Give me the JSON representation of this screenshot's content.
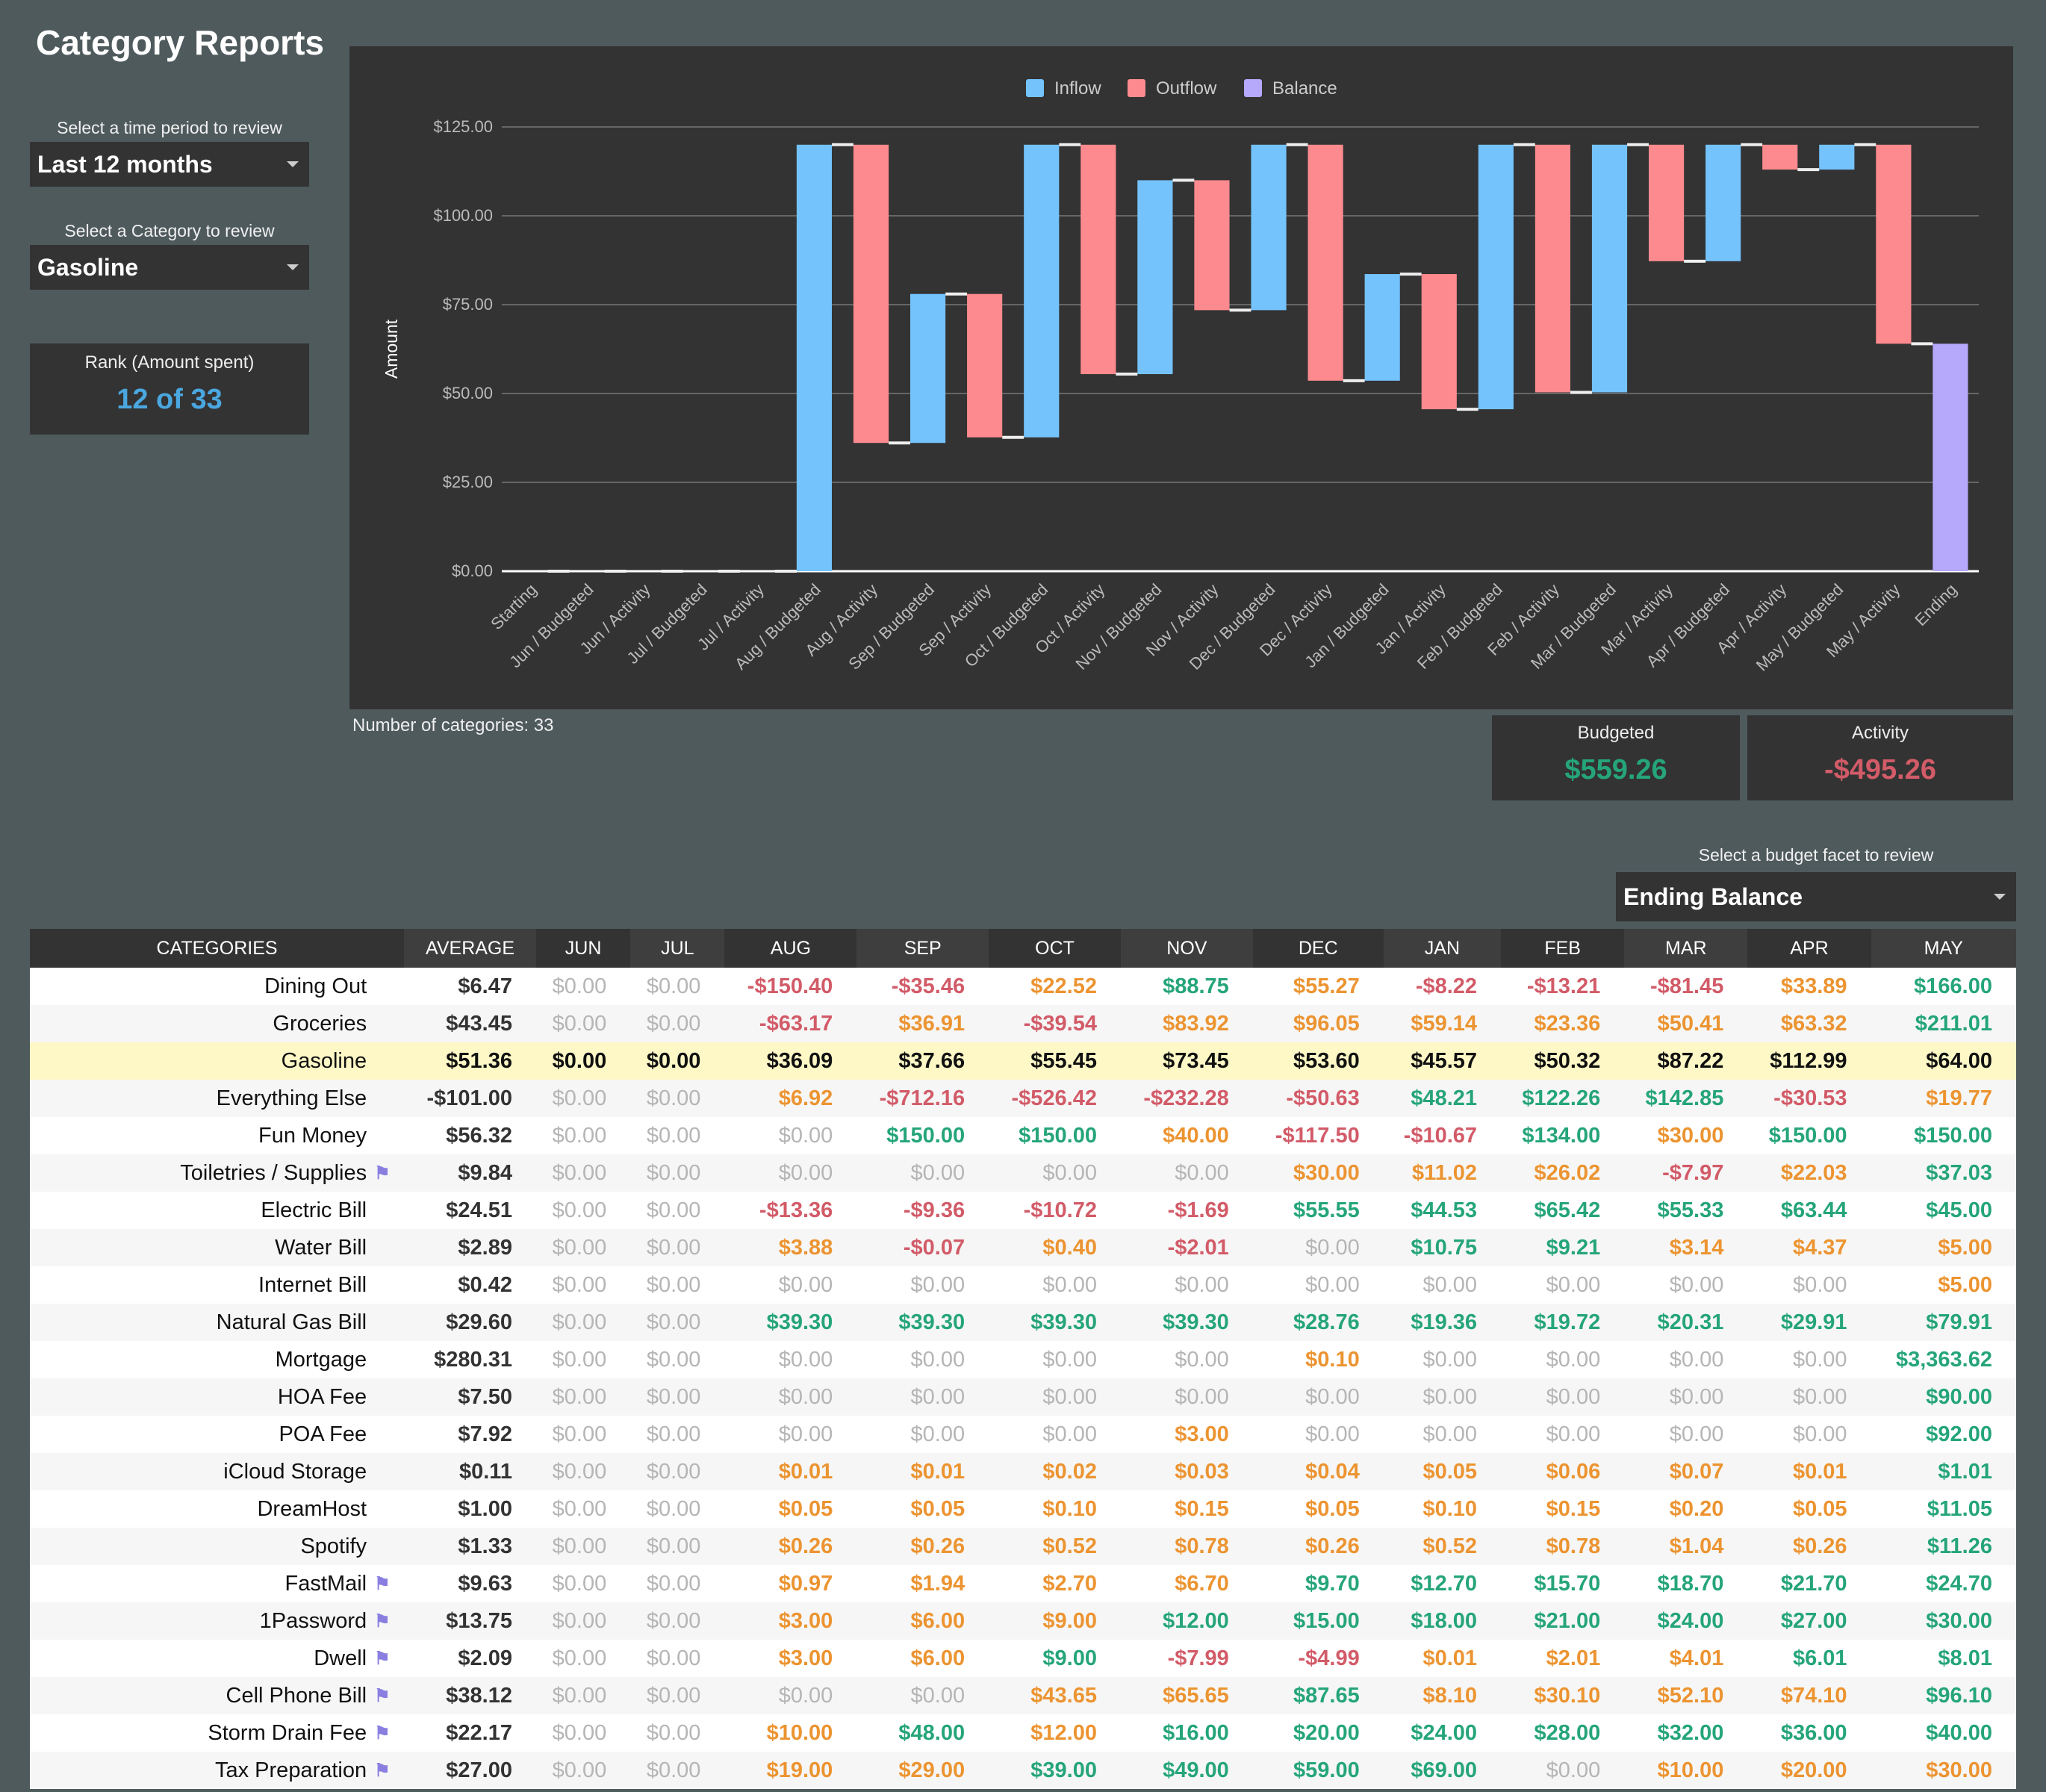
{
  "page": {
    "title": "Category Reports",
    "time_period": {
      "label": "Select a time period to review",
      "value": "Last 12 months"
    },
    "category_select": {
      "label": "Select a Category to review",
      "value": "Gasoline"
    },
    "rank": {
      "label": "Rank (Amount spent)",
      "value": "12 of 33"
    },
    "categories_count": "Number of categories: 33",
    "budgeted": {
      "label": "Budgeted",
      "value": "$559.26"
    },
    "activity": {
      "label": "Activity",
      "value": "-$495.26"
    },
    "facet_select": {
      "label": "Select a budget facet to review",
      "value": "Ending Balance"
    }
  },
  "colors": {
    "inflow": "#74c3fd",
    "outflow": "#fd8a8e",
    "balance": "#b6a8fb",
    "positive": "#25a579",
    "warning": "#ec9431",
    "negative": "#d25b68",
    "rank": "#4aa7e0"
  },
  "chart_data": {
    "type": "bar",
    "subtype": "waterfall",
    "ylabel": "Amount",
    "xlabel": "",
    "ylim": [
      0,
      125
    ],
    "yticks": [
      "$0.00",
      "$25.00",
      "$50.00",
      "$75.00",
      "$100.00",
      "$125.00"
    ],
    "grid": true,
    "legend": {
      "position": "top",
      "entries": [
        "Inflow",
        "Outflow",
        "Balance"
      ]
    },
    "categories": [
      "Starting",
      "Jun / Budgeted",
      "Jun / Activity",
      "Jul / Budgeted",
      "Jul / Activity",
      "Aug / Budgeted",
      "Aug / Activity",
      "Sep / Budgeted",
      "Sep / Activity",
      "Oct / Budgeted",
      "Oct / Activity",
      "Nov / Budgeted",
      "Nov / Activity",
      "Dec / Budgeted",
      "Dec / Activity",
      "Jan / Budgeted",
      "Jan / Activity",
      "Feb / Budgeted",
      "Feb / Activity",
      "Mar / Budgeted",
      "Mar / Activity",
      "Apr / Budgeted",
      "Apr / Activity",
      "May / Budgeted",
      "May / Activity",
      "Ending"
    ],
    "values": [
      0,
      0,
      0,
      0,
      0,
      120.0,
      -83.91,
      41.91,
      -40.34,
      82.34,
      -64.55,
      54.55,
      -36.55,
      46.55,
      -66.4,
      30.0,
      -38.03,
      74.43,
      -69.68,
      69.68,
      -32.78,
      32.78,
      -7.01,
      7.01,
      -56.0,
      64.0
    ],
    "kinds": [
      "balance",
      "inflow",
      "outflow",
      "inflow",
      "outflow",
      "inflow",
      "outflow",
      "inflow",
      "outflow",
      "inflow",
      "outflow",
      "inflow",
      "outflow",
      "inflow",
      "outflow",
      "inflow",
      "outflow",
      "inflow",
      "outflow",
      "inflow",
      "outflow",
      "inflow",
      "outflow",
      "inflow",
      "outflow",
      "balance"
    ]
  },
  "table": {
    "headers": [
      "CATEGORIES",
      "AVERAGE",
      "JUN",
      "JUL",
      "AUG",
      "SEP",
      "OCT",
      "NOV",
      "DEC",
      "JAN",
      "FEB",
      "MAR",
      "APR",
      "MAY"
    ],
    "rows": [
      {
        "name": "Dining Out",
        "flag": false,
        "avg": "$6.47",
        "months": [
          "$0.00",
          "$0.00",
          "-$150.40",
          "-$35.46",
          "$22.52",
          "$88.75",
          "$55.27",
          "-$8.22",
          "-$13.21",
          "-$81.45",
          "$33.89",
          "$166.00"
        ],
        "tones": [
          "z",
          "z",
          "n",
          "n",
          "o",
          "g",
          "o",
          "n",
          "n",
          "n",
          "o",
          "g"
        ]
      },
      {
        "name": "Groceries",
        "flag": false,
        "avg": "$43.45",
        "months": [
          "$0.00",
          "$0.00",
          "-$63.17",
          "$36.91",
          "-$39.54",
          "$83.92",
          "$96.05",
          "$59.14",
          "$23.36",
          "$50.41",
          "$63.32",
          "$211.01"
        ],
        "tones": [
          "z",
          "z",
          "n",
          "o",
          "n",
          "o",
          "o",
          "o",
          "o",
          "o",
          "o",
          "g"
        ]
      },
      {
        "name": "Gasoline",
        "flag": false,
        "highlight": true,
        "avg": "$51.36",
        "months": [
          "$0.00",
          "$0.00",
          "$36.09",
          "$37.66",
          "$55.45",
          "$73.45",
          "$53.60",
          "$45.57",
          "$50.32",
          "$87.22",
          "$112.99",
          "$64.00"
        ],
        "tones": [
          "h",
          "h",
          "h",
          "h",
          "h",
          "h",
          "h",
          "h",
          "h",
          "h",
          "h",
          "h"
        ]
      },
      {
        "name": "Everything Else",
        "flag": false,
        "avg": "-$101.00",
        "months": [
          "$0.00",
          "$0.00",
          "$6.92",
          "-$712.16",
          "-$526.42",
          "-$232.28",
          "-$50.63",
          "$48.21",
          "$122.26",
          "$142.85",
          "-$30.53",
          "$19.77"
        ],
        "tones": [
          "z",
          "z",
          "o",
          "n",
          "n",
          "n",
          "n",
          "g",
          "g",
          "g",
          "n",
          "o"
        ]
      },
      {
        "name": "Fun Money",
        "flag": false,
        "avg": "$56.32",
        "months": [
          "$0.00",
          "$0.00",
          "$0.00",
          "$150.00",
          "$150.00",
          "$40.00",
          "-$117.50",
          "-$10.67",
          "$134.00",
          "$30.00",
          "$150.00",
          "$150.00"
        ],
        "tones": [
          "z",
          "z",
          "z",
          "g",
          "g",
          "o",
          "n",
          "n",
          "g",
          "o",
          "g",
          "g"
        ]
      },
      {
        "name": "Toiletries / Supplies",
        "flag": true,
        "avg": "$9.84",
        "months": [
          "$0.00",
          "$0.00",
          "$0.00",
          "$0.00",
          "$0.00",
          "$0.00",
          "$30.00",
          "$11.02",
          "$26.02",
          "-$7.97",
          "$22.03",
          "$37.03"
        ],
        "tones": [
          "z",
          "z",
          "z",
          "z",
          "z",
          "z",
          "o",
          "o",
          "o",
          "n",
          "o",
          "g"
        ]
      },
      {
        "name": "Electric Bill",
        "flag": false,
        "avg": "$24.51",
        "months": [
          "$0.00",
          "$0.00",
          "-$13.36",
          "-$9.36",
          "-$10.72",
          "-$1.69",
          "$55.55",
          "$44.53",
          "$65.42",
          "$55.33",
          "$63.44",
          "$45.00"
        ],
        "tones": [
          "z",
          "z",
          "n",
          "n",
          "n",
          "n",
          "g",
          "g",
          "g",
          "g",
          "g",
          "g"
        ]
      },
      {
        "name": "Water Bill",
        "flag": false,
        "avg": "$2.89",
        "months": [
          "$0.00",
          "$0.00",
          "$3.88",
          "-$0.07",
          "$0.40",
          "-$2.01",
          "$0.00",
          "$10.75",
          "$9.21",
          "$3.14",
          "$4.37",
          "$5.00"
        ],
        "tones": [
          "z",
          "z",
          "o",
          "n",
          "o",
          "n",
          "z",
          "g",
          "g",
          "o",
          "o",
          "o"
        ]
      },
      {
        "name": "Internet Bill",
        "flag": false,
        "avg": "$0.42",
        "months": [
          "$0.00",
          "$0.00",
          "$0.00",
          "$0.00",
          "$0.00",
          "$0.00",
          "$0.00",
          "$0.00",
          "$0.00",
          "$0.00",
          "$0.00",
          "$5.00"
        ],
        "tones": [
          "z",
          "z",
          "z",
          "z",
          "z",
          "z",
          "z",
          "z",
          "z",
          "z",
          "z",
          "o"
        ]
      },
      {
        "name": "Natural Gas Bill",
        "flag": false,
        "avg": "$29.60",
        "months": [
          "$0.00",
          "$0.00",
          "$39.30",
          "$39.30",
          "$39.30",
          "$39.30",
          "$28.76",
          "$19.36",
          "$19.72",
          "$20.31",
          "$29.91",
          "$79.91"
        ],
        "tones": [
          "z",
          "z",
          "g",
          "g",
          "g",
          "g",
          "g",
          "g",
          "g",
          "g",
          "g",
          "g"
        ]
      },
      {
        "name": "Mortgage",
        "flag": false,
        "avg": "$280.31",
        "months": [
          "$0.00",
          "$0.00",
          "$0.00",
          "$0.00",
          "$0.00",
          "$0.00",
          "$0.10",
          "$0.00",
          "$0.00",
          "$0.00",
          "$0.00",
          "$3,363.62"
        ],
        "tones": [
          "z",
          "z",
          "z",
          "z",
          "z",
          "z",
          "o",
          "z",
          "z",
          "z",
          "z",
          "g"
        ]
      },
      {
        "name": "HOA Fee",
        "flag": false,
        "avg": "$7.50",
        "months": [
          "$0.00",
          "$0.00",
          "$0.00",
          "$0.00",
          "$0.00",
          "$0.00",
          "$0.00",
          "$0.00",
          "$0.00",
          "$0.00",
          "$0.00",
          "$90.00"
        ],
        "tones": [
          "z",
          "z",
          "z",
          "z",
          "z",
          "z",
          "z",
          "z",
          "z",
          "z",
          "z",
          "g"
        ]
      },
      {
        "name": "POA Fee",
        "flag": false,
        "avg": "$7.92",
        "months": [
          "$0.00",
          "$0.00",
          "$0.00",
          "$0.00",
          "$0.00",
          "$3.00",
          "$0.00",
          "$0.00",
          "$0.00",
          "$0.00",
          "$0.00",
          "$92.00"
        ],
        "tones": [
          "z",
          "z",
          "z",
          "z",
          "z",
          "o",
          "z",
          "z",
          "z",
          "z",
          "z",
          "g"
        ]
      },
      {
        "name": "iCloud Storage",
        "flag": false,
        "avg": "$0.11",
        "months": [
          "$0.00",
          "$0.00",
          "$0.01",
          "$0.01",
          "$0.02",
          "$0.03",
          "$0.04",
          "$0.05",
          "$0.06",
          "$0.07",
          "$0.01",
          "$1.01"
        ],
        "tones": [
          "z",
          "z",
          "o",
          "o",
          "o",
          "o",
          "o",
          "o",
          "o",
          "o",
          "o",
          "g"
        ]
      },
      {
        "name": "DreamHost",
        "flag": false,
        "avg": "$1.00",
        "months": [
          "$0.00",
          "$0.00",
          "$0.05",
          "$0.05",
          "$0.10",
          "$0.15",
          "$0.05",
          "$0.10",
          "$0.15",
          "$0.20",
          "$0.05",
          "$11.05"
        ],
        "tones": [
          "z",
          "z",
          "o",
          "o",
          "o",
          "o",
          "o",
          "o",
          "o",
          "o",
          "o",
          "g"
        ]
      },
      {
        "name": "Spotify",
        "flag": false,
        "avg": "$1.33",
        "months": [
          "$0.00",
          "$0.00",
          "$0.26",
          "$0.26",
          "$0.52",
          "$0.78",
          "$0.26",
          "$0.52",
          "$0.78",
          "$1.04",
          "$0.26",
          "$11.26"
        ],
        "tones": [
          "z",
          "z",
          "o",
          "o",
          "o",
          "o",
          "o",
          "o",
          "o",
          "o",
          "o",
          "g"
        ]
      },
      {
        "name": "FastMail",
        "flag": true,
        "avg": "$9.63",
        "months": [
          "$0.00",
          "$0.00",
          "$0.97",
          "$1.94",
          "$2.70",
          "$6.70",
          "$9.70",
          "$12.70",
          "$15.70",
          "$18.70",
          "$21.70",
          "$24.70"
        ],
        "tones": [
          "z",
          "z",
          "o",
          "o",
          "o",
          "o",
          "g",
          "g",
          "g",
          "g",
          "g",
          "g"
        ]
      },
      {
        "name": "1Password",
        "flag": true,
        "avg": "$13.75",
        "months": [
          "$0.00",
          "$0.00",
          "$3.00",
          "$6.00",
          "$9.00",
          "$12.00",
          "$15.00",
          "$18.00",
          "$21.00",
          "$24.00",
          "$27.00",
          "$30.00"
        ],
        "tones": [
          "z",
          "z",
          "o",
          "o",
          "o",
          "g",
          "g",
          "g",
          "g",
          "g",
          "g",
          "g"
        ]
      },
      {
        "name": "Dwell",
        "flag": true,
        "avg": "$2.09",
        "months": [
          "$0.00",
          "$0.00",
          "$3.00",
          "$6.00",
          "$9.00",
          "-$7.99",
          "-$4.99",
          "$0.01",
          "$2.01",
          "$4.01",
          "$6.01",
          "$8.01"
        ],
        "tones": [
          "z",
          "z",
          "o",
          "o",
          "g",
          "n",
          "n",
          "o",
          "o",
          "o",
          "g",
          "g"
        ]
      },
      {
        "name": "Cell Phone Bill",
        "flag": true,
        "avg": "$38.12",
        "months": [
          "$0.00",
          "$0.00",
          "$0.00",
          "$0.00",
          "$43.65",
          "$65.65",
          "$87.65",
          "$8.10",
          "$30.10",
          "$52.10",
          "$74.10",
          "$96.10"
        ],
        "tones": [
          "z",
          "z",
          "z",
          "z",
          "o",
          "o",
          "g",
          "o",
          "o",
          "o",
          "o",
          "g"
        ]
      },
      {
        "name": "Storm Drain Fee",
        "flag": true,
        "avg": "$22.17",
        "months": [
          "$0.00",
          "$0.00",
          "$10.00",
          "$48.00",
          "$12.00",
          "$16.00",
          "$20.00",
          "$24.00",
          "$28.00",
          "$32.00",
          "$36.00",
          "$40.00"
        ],
        "tones": [
          "z",
          "z",
          "o",
          "g",
          "o",
          "g",
          "g",
          "g",
          "g",
          "g",
          "g",
          "g"
        ]
      },
      {
        "name": "Tax Preparation",
        "flag": true,
        "avg": "$27.00",
        "months": [
          "$0.00",
          "$0.00",
          "$19.00",
          "$29.00",
          "$39.00",
          "$49.00",
          "$59.00",
          "$69.00",
          "$0.00",
          "$10.00",
          "$20.00",
          "$30.00"
        ],
        "tones": [
          "z",
          "z",
          "o",
          "o",
          "g",
          "g",
          "g",
          "g",
          "z",
          "o",
          "o",
          "o"
        ]
      }
    ]
  }
}
